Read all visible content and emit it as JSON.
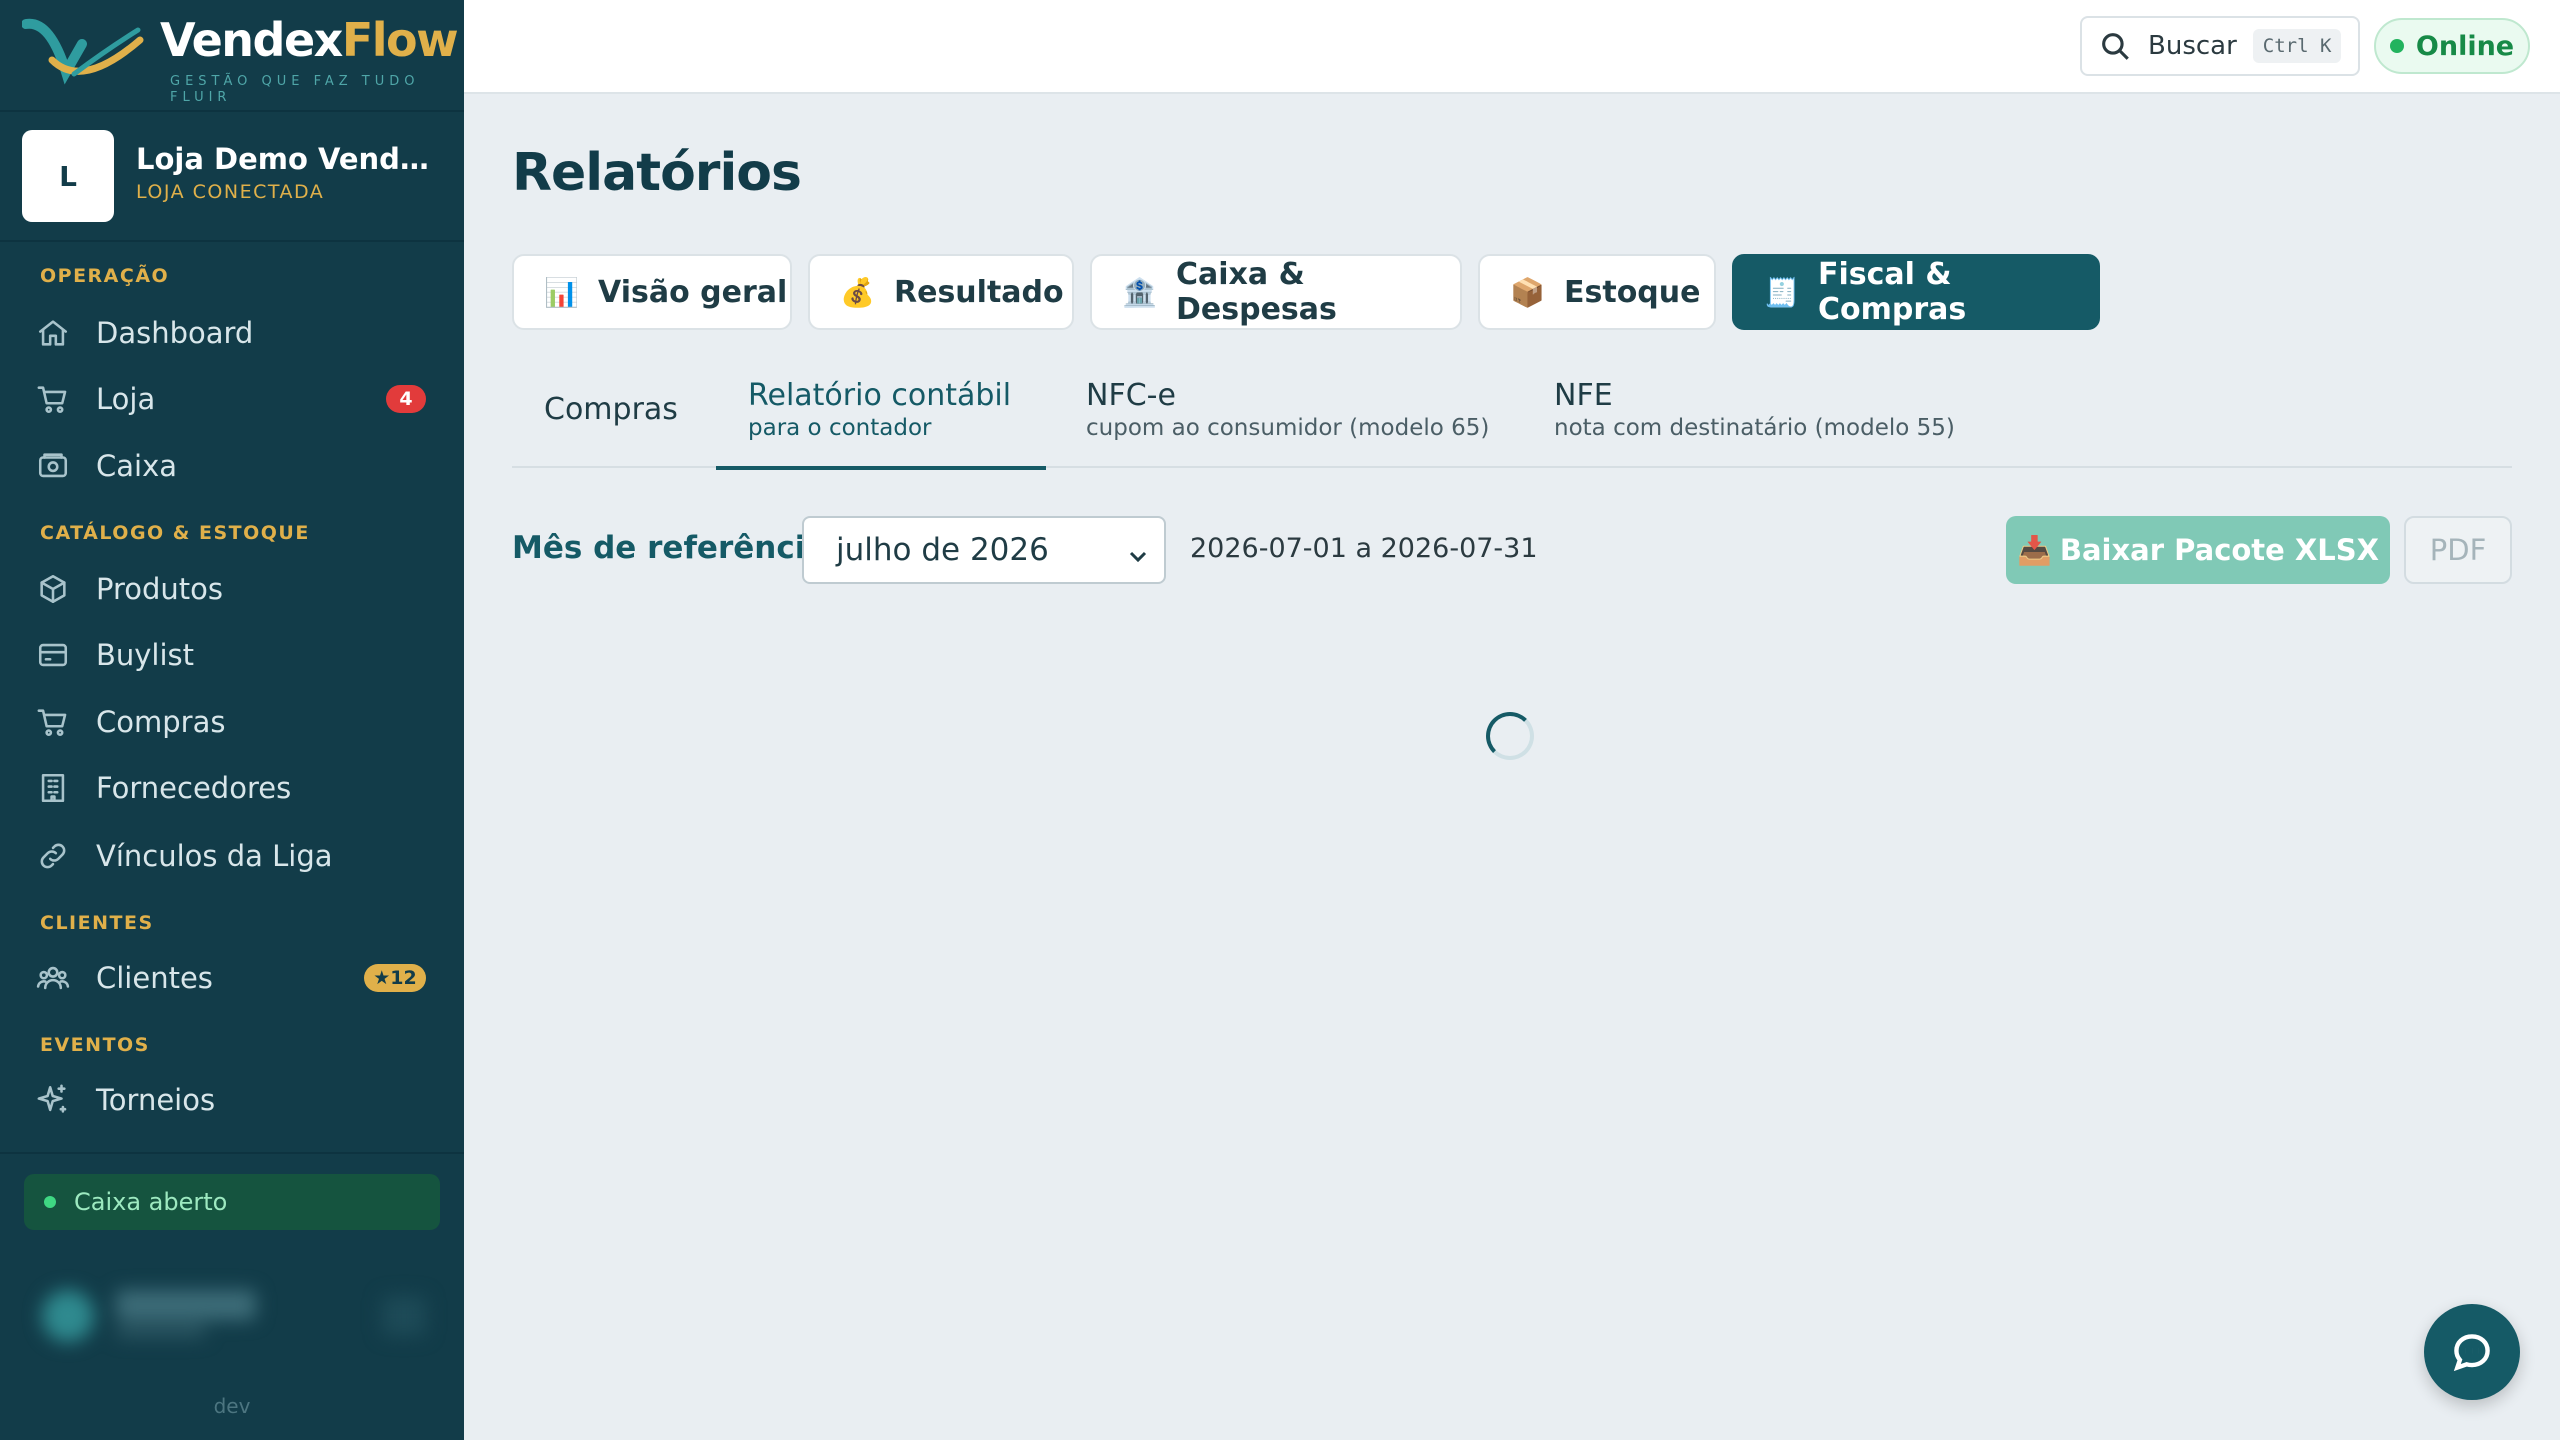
{
  "brand": {
    "name_part1": "Vendex",
    "name_part2": "Flow",
    "tagline": "GESTÃO QUE FAZ TUDO FLUIR"
  },
  "store": {
    "initial": "L",
    "name": "Loja Demo VendexFlow",
    "status": "LOJA CONECTADA"
  },
  "sidebar": {
    "sections": [
      {
        "title": "OPERAÇÃO"
      },
      {
        "title": "CATÁLOGO & ESTOQUE"
      },
      {
        "title": "CLIENTES"
      },
      {
        "title": "EVENTOS"
      }
    ],
    "items": [
      {
        "label": "Dashboard",
        "icon": "home-icon"
      },
      {
        "label": "Loja",
        "icon": "cart-icon",
        "badge": "4"
      },
      {
        "label": "Caixa",
        "icon": "cash-register-icon"
      },
      {
        "label": "Produtos",
        "icon": "box-icon"
      },
      {
        "label": "Buylist",
        "icon": "card-icon"
      },
      {
        "label": "Compras",
        "icon": "cart-icon"
      },
      {
        "label": "Fornecedores",
        "icon": "building-icon"
      },
      {
        "label": "Vínculos da Liga",
        "icon": "link-icon"
      },
      {
        "label": "Clientes",
        "icon": "users-icon",
        "badge": "★12"
      },
      {
        "label": "Torneios",
        "icon": "sparkle-icon"
      }
    ],
    "cash_status": "Caixa aberto",
    "env": "dev"
  },
  "topbar": {
    "search_label": "Buscar",
    "shortcut": "Ctrl K",
    "status": "Online"
  },
  "page": {
    "title": "Relatórios",
    "tabs": [
      {
        "emoji": "📊",
        "label": "Visão geral"
      },
      {
        "emoji": "💰",
        "label": "Resultado"
      },
      {
        "emoji": "🏦",
        "label": "Caixa & Despesas"
      },
      {
        "emoji": "📦",
        "label": "Estoque"
      },
      {
        "emoji": "🧾",
        "label": "Fiscal & Compras",
        "active": true
      }
    ],
    "subtabs": [
      {
        "label": "Compras"
      },
      {
        "label": "Relatório contábil",
        "sub": "para o contador",
        "active": true
      },
      {
        "label": "NFC-e",
        "sub": "cupom ao consumidor (modelo 65)"
      },
      {
        "label": "NFE",
        "sub": "nota com destinatário (modelo 55)"
      }
    ],
    "filter": {
      "label": "Mês de referência:",
      "month": "julho de 2026",
      "range": "2026-07-01 a 2026-07-31"
    },
    "actions": {
      "xlsx_emoji": "📥",
      "xlsx_label": "Baixar Pacote XLSX",
      "pdf_label": "PDF"
    }
  },
  "colors": {
    "sidebar_bg": "#123c49",
    "accent": "#155a66",
    "gold": "#e0b04a",
    "online": "#22b35e",
    "badge_red": "#e23b3b"
  }
}
